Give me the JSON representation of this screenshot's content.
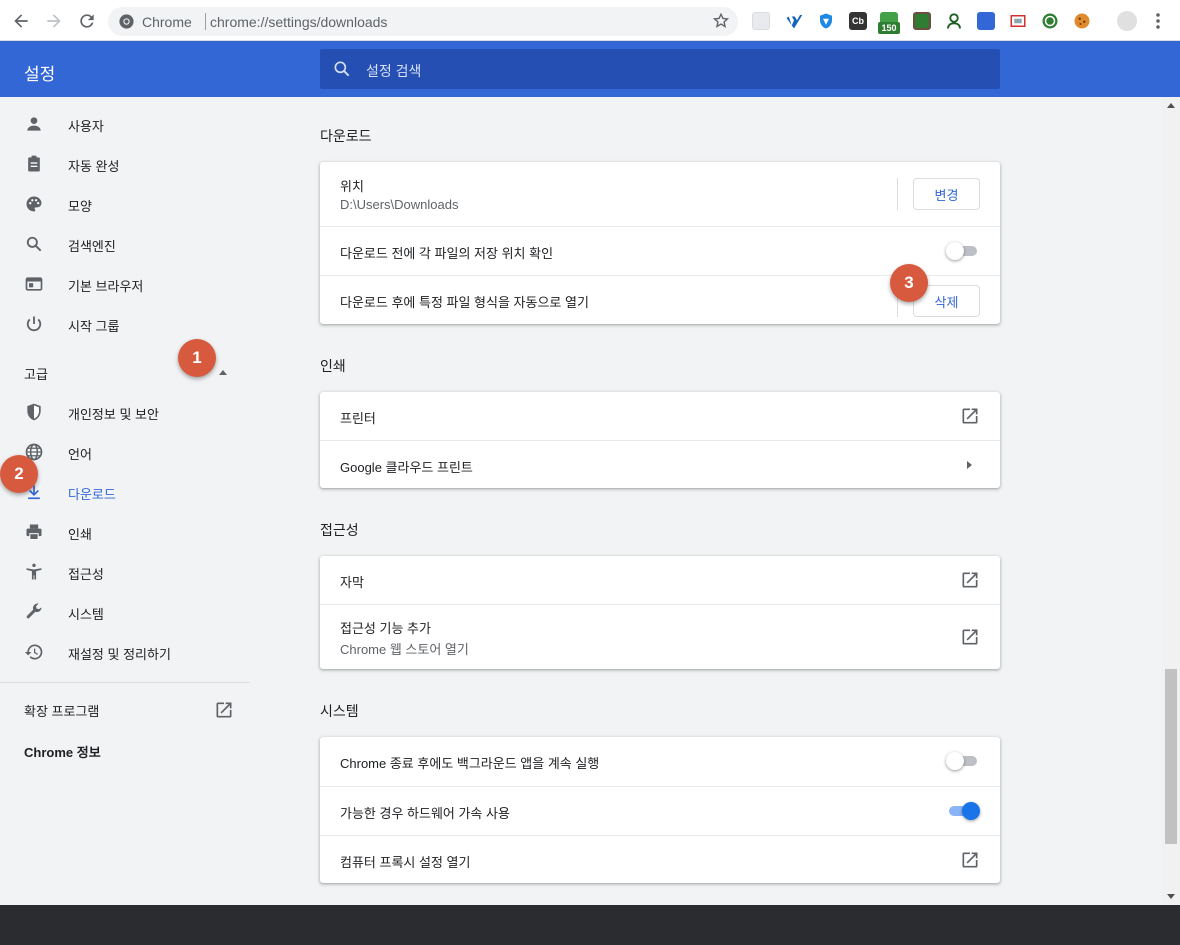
{
  "browser": {
    "site_label": "Chrome",
    "url": "chrome://settings/downloads",
    "extension_badge": "150",
    "extensions": [
      "extension-icon",
      "vimeo-icon",
      "shield-icon",
      "cb-icon",
      "green-extension-icon",
      "picture-icon",
      "person-badge-icon",
      "window-icon",
      "cast-icon",
      "whatsapp-icon",
      "cookie-icon",
      "profile-icon"
    ]
  },
  "header": {
    "title": "설정",
    "search_placeholder": "설정 검색"
  },
  "sidebar": {
    "items": [
      {
        "label": "사용자",
        "icon": "person-icon"
      },
      {
        "label": "자동 완성",
        "icon": "clipboard-icon"
      },
      {
        "label": "모양",
        "icon": "palette-icon"
      },
      {
        "label": "검색엔진",
        "icon": "search-icon"
      },
      {
        "label": "기본 브라우저",
        "icon": "browser-window-icon"
      },
      {
        "label": "시작 그룹",
        "icon": "power-icon"
      }
    ],
    "advanced_label": "고급",
    "advanced_items": [
      {
        "label": "개인정보 및 보안",
        "icon": "shield-icon"
      },
      {
        "label": "언어",
        "icon": "globe-icon"
      },
      {
        "label": "다운로드",
        "icon": "download-icon"
      },
      {
        "label": "인쇄",
        "icon": "printer-icon"
      },
      {
        "label": "접근성",
        "icon": "accessibility-icon"
      },
      {
        "label": "시스템",
        "icon": "wrench-icon"
      },
      {
        "label": "재설정 및 정리하기",
        "icon": "history-icon"
      }
    ],
    "extensions_label": "확장 프로그램",
    "about_label": "Chrome 정보",
    "active_color": "#3367d6"
  },
  "markers": [
    "1",
    "2",
    "3"
  ],
  "main": {
    "downloads": {
      "title": "다운로드",
      "location_label": "위치",
      "location_value": "D:\\Users\\Downloads",
      "change_button": "변경",
      "ask_label": "다운로드 전에 각 파일의 저장 위치 확인",
      "ask_enabled": false,
      "auto_open_label": "다운로드 후에 특정 파일 형식을 자동으로 열기",
      "clear_button": "삭제"
    },
    "printing": {
      "title": "인쇄",
      "printers_label": "프린터",
      "cloud_print_label": "Google 클라우드 프린트"
    },
    "accessibility": {
      "title": "접근성",
      "captions_label": "자막",
      "add_features_label": "접근성 기능 추가",
      "add_features_sub": "Chrome 웹 스토어 열기"
    },
    "system": {
      "title": "시스템",
      "background_label": "Chrome 종료 후에도 백그라운드 앱을 계속 실행",
      "background_enabled": false,
      "hardware_label": "가능한 경우 하드웨어 가속 사용",
      "hardware_enabled": true,
      "proxy_label": "컴퓨터 프록시 설정 열기"
    }
  },
  "colors": {
    "header_blue": "#3367d6",
    "marker": "#d75a3f",
    "toggle_on": "#1a73e8"
  }
}
